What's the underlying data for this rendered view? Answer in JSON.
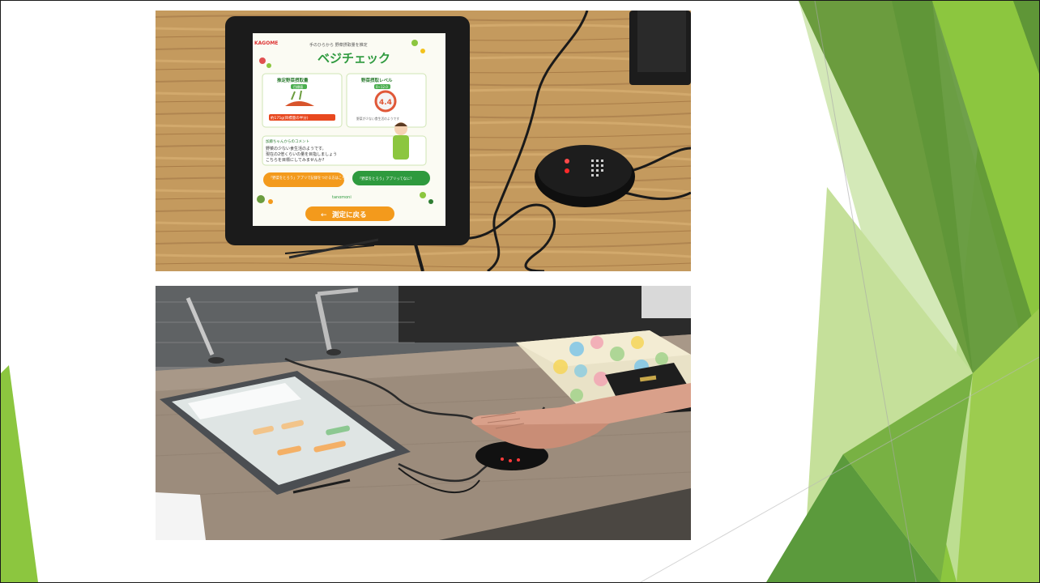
{
  "slide": {
    "photos": [
      {
        "id": "tablet-with-sensor"
      },
      {
        "id": "hand-on-sensor"
      }
    ],
    "app_screen": {
      "brand": "KAGOME",
      "tagline": "手のひらから 野菜摂取量を推定",
      "title": "ベジチェック",
      "left_card_title": "推定野菜摂取量",
      "left_card_badge": "目標値",
      "left_card_value": "約175g(目標量の半分)",
      "right_card_title": "野菜摂取レベル",
      "right_card_badge": "0~12.0",
      "score": "4.4",
      "right_card_note": "野菜が少ない食生活のようです",
      "comment_header": "加藤ちゃんからのコメント",
      "comment_line1": "野菜の少ない食生活のようです。",
      "comment_line2": "現在の2倍くらいの量を目指しましょう",
      "comment_line3": "こちらを目標にしてみませんか?",
      "button_orange": "「野菜をとろう」アプリで記録をつける方はこちら",
      "button_green": "「野菜をとろう」アプリってなに?",
      "sponsor": "tanomoni",
      "back_button": "測定に戻る"
    },
    "colors": {
      "green_dark": "#6a9f3e",
      "green_mid": "#8cc63f",
      "green_light": "#c5e09a",
      "orange": "#f39a1c",
      "app_green": "#2e9a3e"
    }
  }
}
